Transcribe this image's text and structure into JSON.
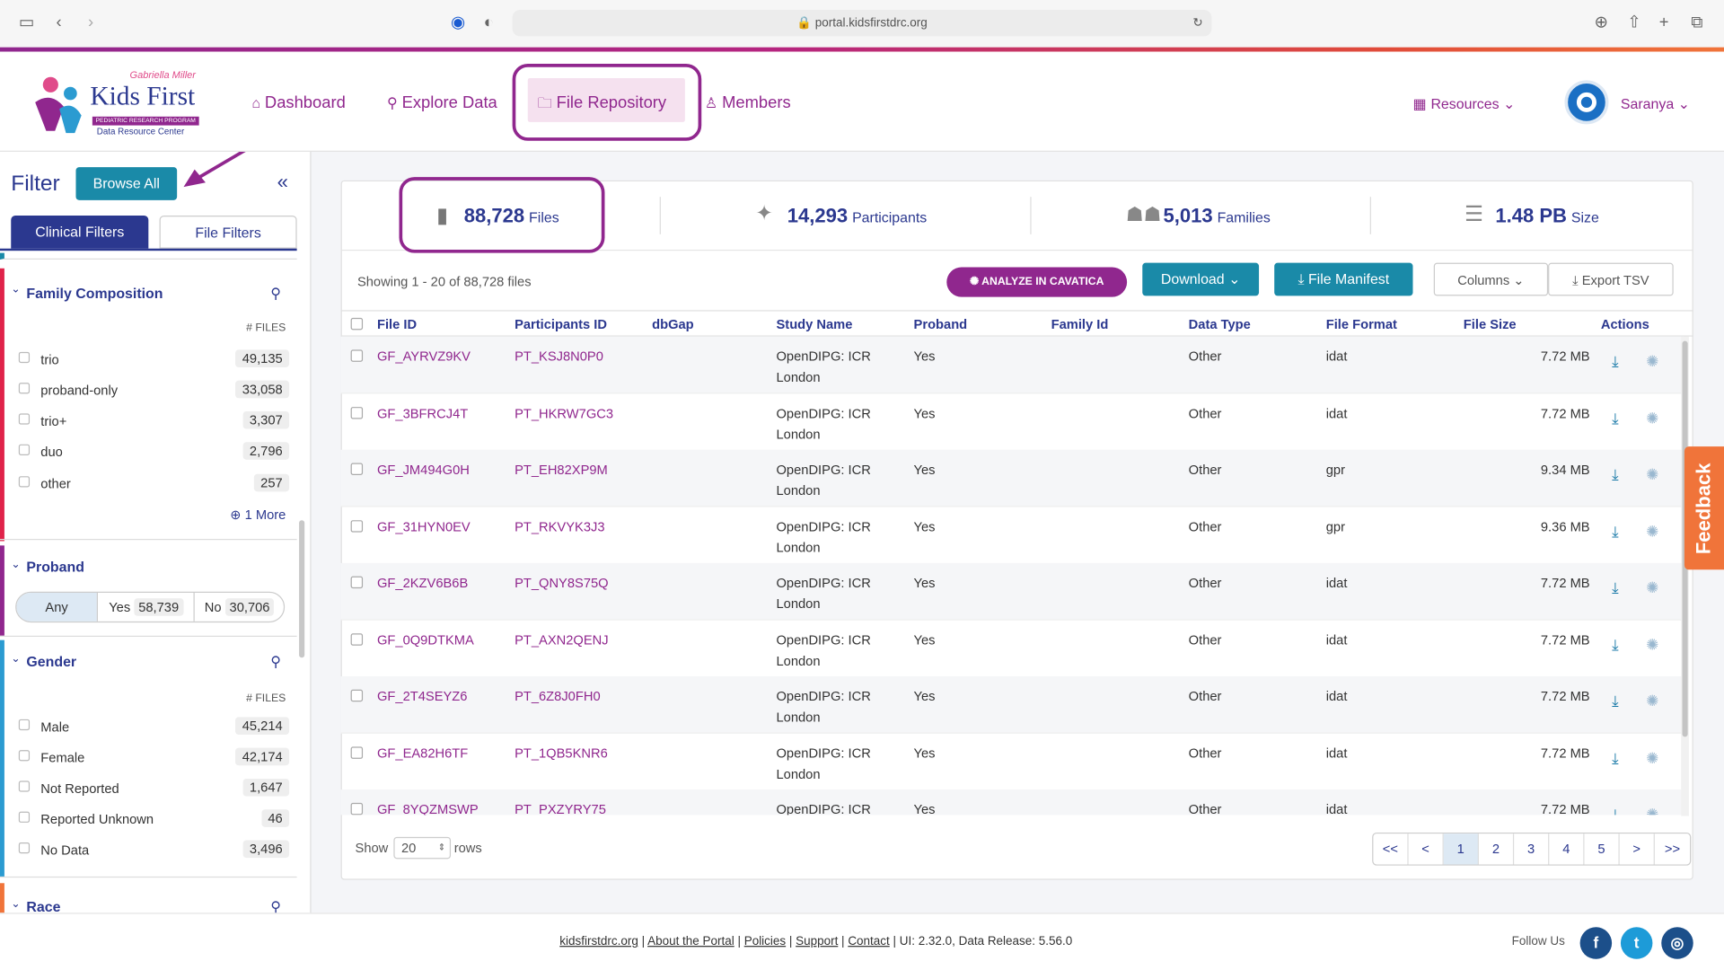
{
  "browser": {
    "url": "portal.kidsfirstdrc.org"
  },
  "header": {
    "logo": {
      "tagline": "Gabriella Miller",
      "name": "Kids First",
      "sub1": "PEDIATRIC RESEARCH PROGRAM",
      "sub2": "Data Resource Center"
    },
    "nav": {
      "dashboard": "Dashboard",
      "explore": "Explore Data",
      "files": "File Repository",
      "members": "Members"
    },
    "resources": "Resources",
    "user": "Saranya"
  },
  "sidebar": {
    "title": "Filter",
    "browse_all": "Browse All",
    "tabs": {
      "clinical": "Clinical Filters",
      "file": "File Filters"
    },
    "files_header": "# FILES",
    "family": {
      "title": "Family Composition",
      "items": [
        {
          "label": "trio",
          "count": "49,135"
        },
        {
          "label": "proband-only",
          "count": "33,058"
        },
        {
          "label": "trio+",
          "count": "3,307"
        },
        {
          "label": "duo",
          "count": "2,796"
        },
        {
          "label": "other",
          "count": "257"
        }
      ],
      "more": "1 More"
    },
    "proband": {
      "title": "Proband",
      "any": "Any",
      "yes": "Yes",
      "yes_count": "58,739",
      "no": "No",
      "no_count": "30,706"
    },
    "gender": {
      "title": "Gender",
      "items": [
        {
          "label": "Male",
          "count": "45,214"
        },
        {
          "label": "Female",
          "count": "42,174"
        },
        {
          "label": "Not Reported",
          "count": "1,647"
        },
        {
          "label": "Reported Unknown",
          "count": "46"
        },
        {
          "label": "No Data",
          "count": "3,496"
        }
      ]
    },
    "race": {
      "title": "Race"
    }
  },
  "stats": {
    "files": "88,728",
    "files_label": "Files",
    "participants": "14,293",
    "participants_label": "Participants",
    "families": "5,013",
    "families_label": "Families",
    "size": "1.48 PB",
    "size_label": "Size"
  },
  "toolbar": {
    "showing": "Showing 1 - 20 of 88,728 files",
    "cavatica": "ANALYZE IN CAVATICA",
    "download": "Download",
    "manifest": "File Manifest",
    "columns": "Columns",
    "export": "Export TSV"
  },
  "table": {
    "columns": [
      "File ID",
      "Participants ID",
      "dbGap",
      "Study Name",
      "Proband",
      "Family Id",
      "Data Type",
      "File Format",
      "File Size",
      "Actions"
    ],
    "rows": [
      {
        "file_id": "GF_AYRVZ9KV",
        "participant": "PT_KSJ8N0P0",
        "study1": "OpenDIPG: ICR",
        "study2": "London",
        "proband": "Yes",
        "data_type": "Other",
        "format": "idat",
        "size": "7.72 MB"
      },
      {
        "file_id": "GF_3BFRCJ4T",
        "participant": "PT_HKRW7GC3",
        "study1": "OpenDIPG: ICR",
        "study2": "London",
        "proband": "Yes",
        "data_type": "Other",
        "format": "idat",
        "size": "7.72 MB"
      },
      {
        "file_id": "GF_JM494G0H",
        "participant": "PT_EH82XP9M",
        "study1": "OpenDIPG: ICR",
        "study2": "London",
        "proband": "Yes",
        "data_type": "Other",
        "format": "gpr",
        "size": "9.34 MB"
      },
      {
        "file_id": "GF_31HYN0EV",
        "participant": "PT_RKVYK3J3",
        "study1": "OpenDIPG: ICR",
        "study2": "London",
        "proband": "Yes",
        "data_type": "Other",
        "format": "gpr",
        "size": "9.36 MB"
      },
      {
        "file_id": "GF_2KZV6B6B",
        "participant": "PT_QNY8S75Q",
        "study1": "OpenDIPG: ICR",
        "study2": "London",
        "proband": "Yes",
        "data_type": "Other",
        "format": "idat",
        "size": "7.72 MB"
      },
      {
        "file_id": "GF_0Q9DTKMA",
        "participant": "PT_AXN2QENJ",
        "study1": "OpenDIPG: ICR",
        "study2": "London",
        "proband": "Yes",
        "data_type": "Other",
        "format": "idat",
        "size": "7.72 MB"
      },
      {
        "file_id": "GF_2T4SEYZ6",
        "participant": "PT_6Z8J0FH0",
        "study1": "OpenDIPG: ICR",
        "study2": "London",
        "proband": "Yes",
        "data_type": "Other",
        "format": "idat",
        "size": "7.72 MB"
      },
      {
        "file_id": "GF_EA82H6TF",
        "participant": "PT_1QB5KNR6",
        "study1": "OpenDIPG: ICR",
        "study2": "London",
        "proband": "Yes",
        "data_type": "Other",
        "format": "idat",
        "size": "7.72 MB"
      },
      {
        "file_id": "GF_8YQZMSWP",
        "participant": "PT_PXZYRY75",
        "study1": "OpenDIPG: ICR",
        "study2": "",
        "proband": "Yes",
        "data_type": "Other",
        "format": "idat",
        "size": "7.72 MB"
      }
    ]
  },
  "pagination": {
    "show": "Show",
    "rows_value": "20",
    "rows": "rows",
    "pages": [
      "<<",
      "<",
      "1",
      "2",
      "3",
      "4",
      "5",
      ">",
      ">>"
    ],
    "current": "1"
  },
  "footer": {
    "links": [
      "kidsfirstdrc.org",
      "About the Portal",
      "Policies",
      "Support",
      "Contact"
    ],
    "version": "| UI: 2.32.0, Data Release: 5.56.0",
    "follow": "Follow Us"
  },
  "feedback": "Feedback",
  "colors": {
    "brand_purple": "#90278e",
    "brand_blue": "#2b388f",
    "teal": "#1a8aa8",
    "orange": "#f0743a"
  }
}
